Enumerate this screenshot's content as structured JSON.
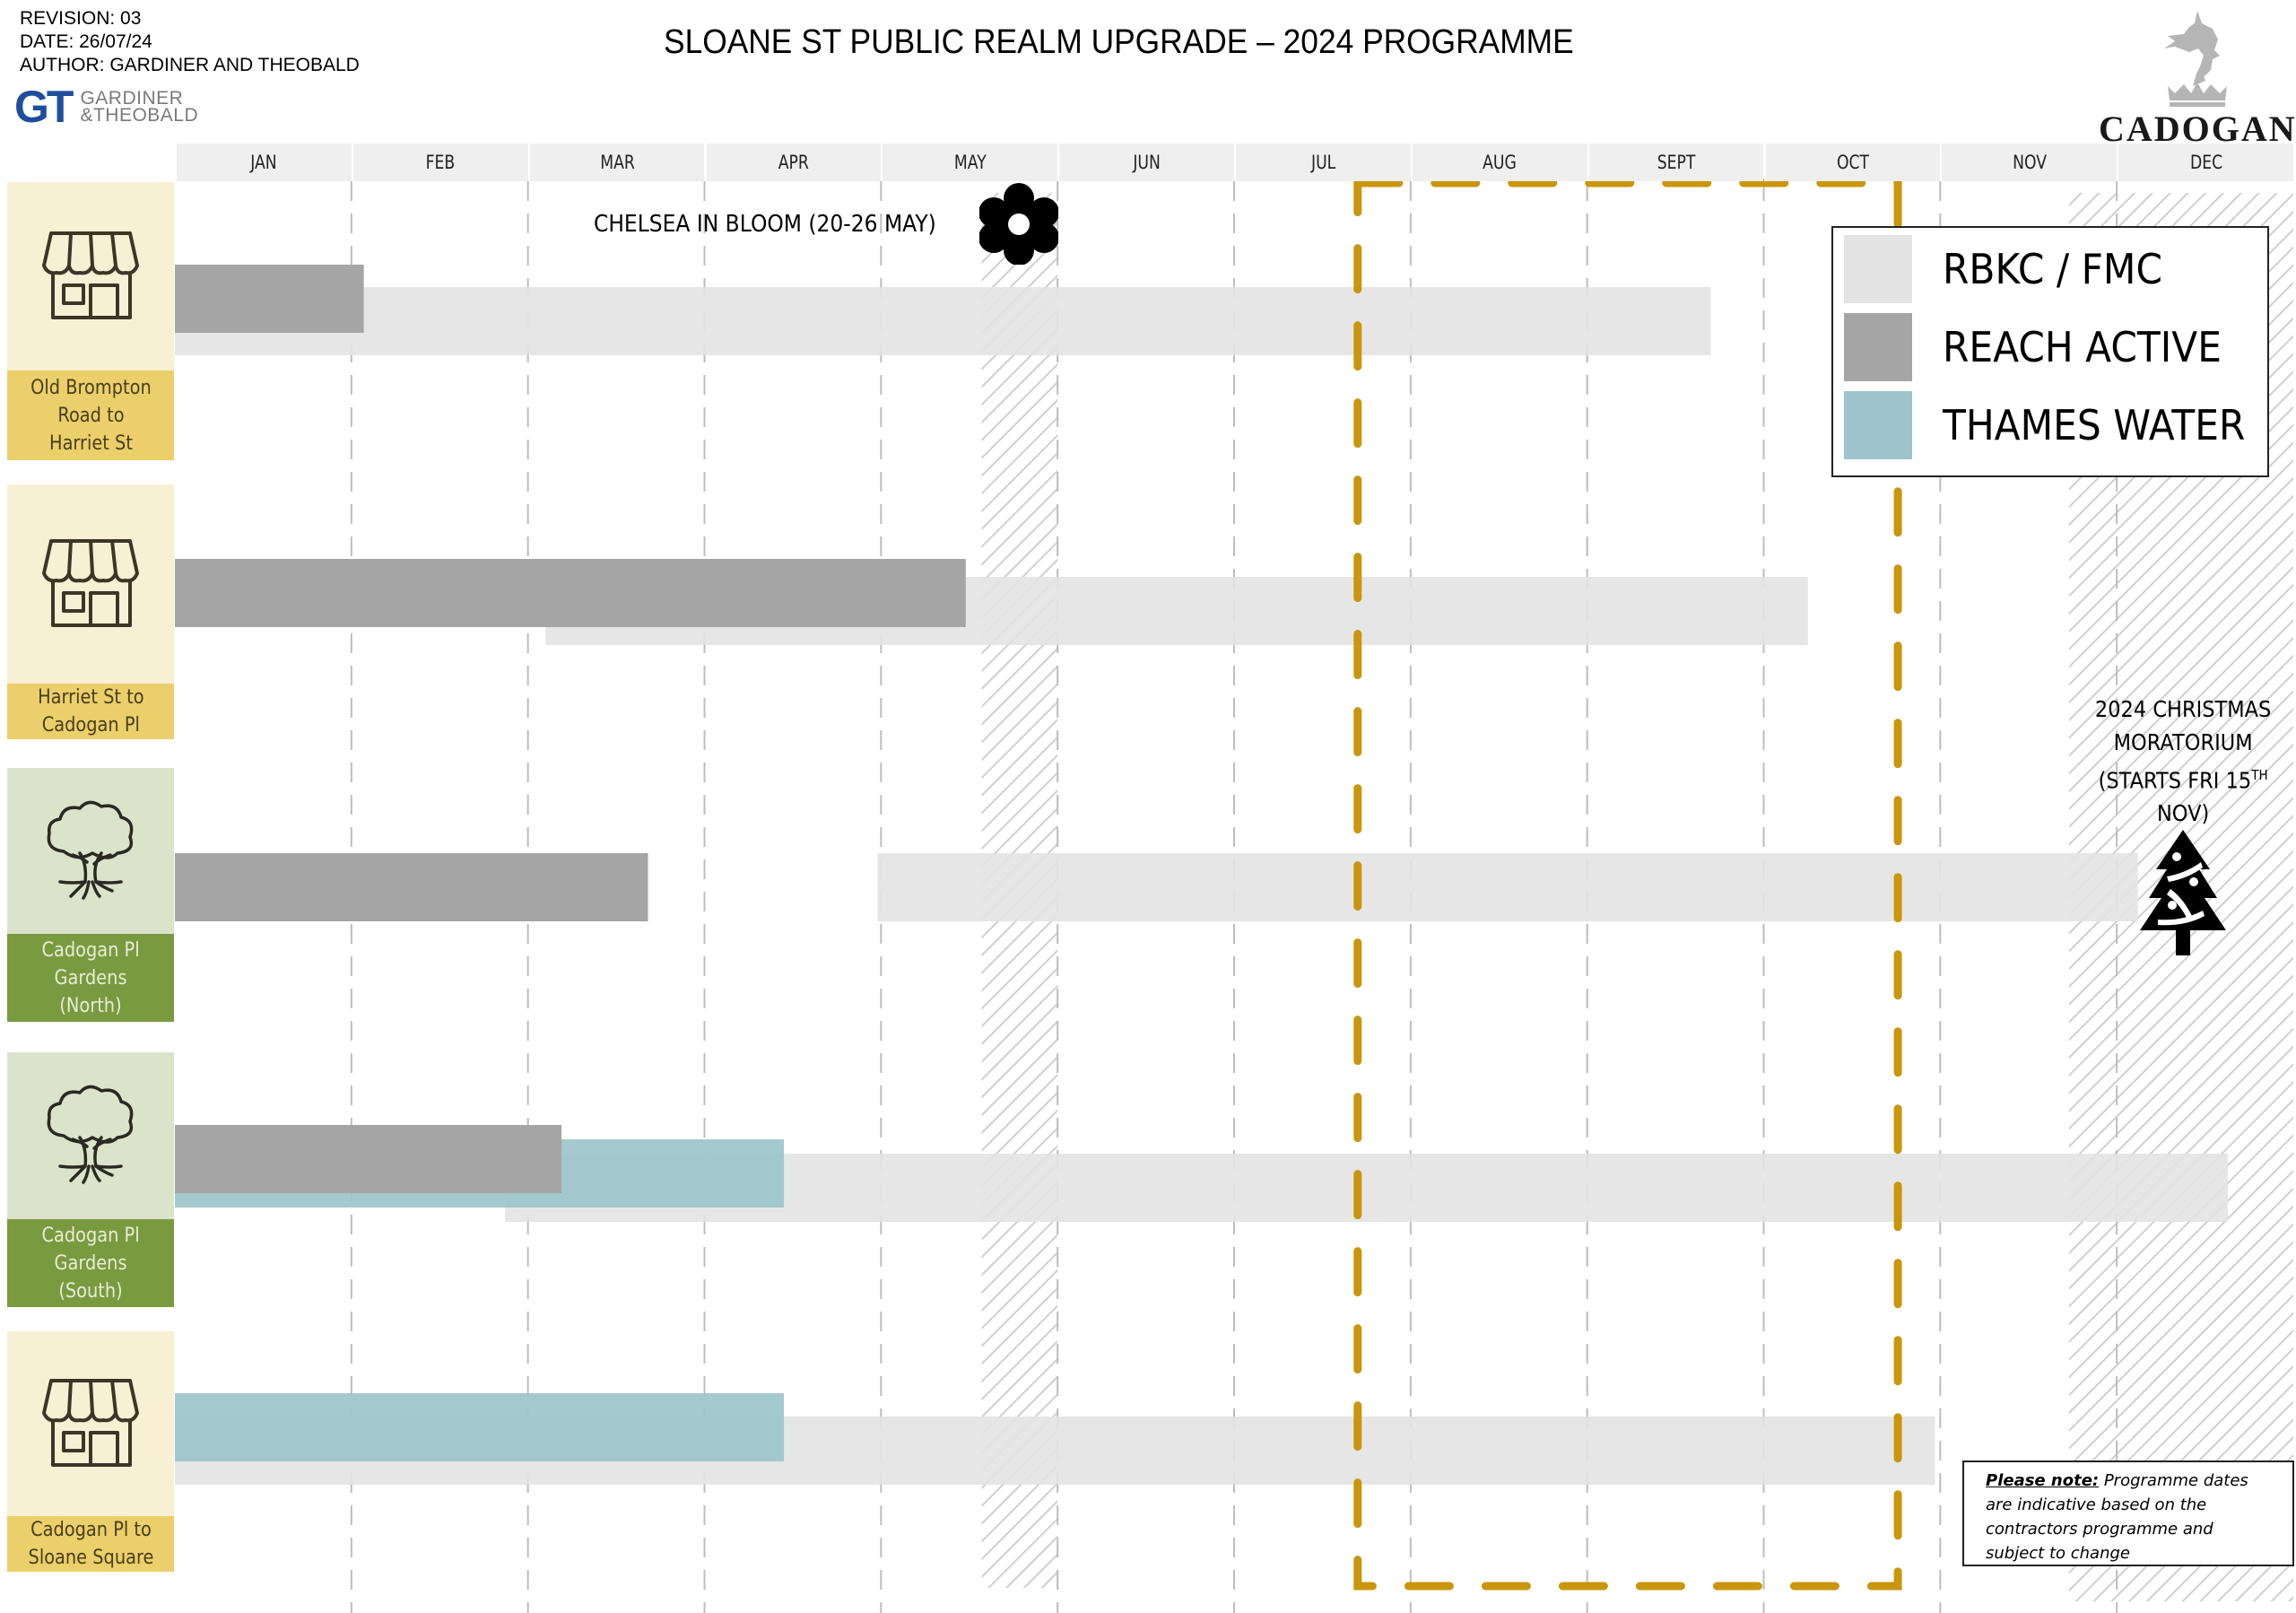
{
  "header": {
    "revision": "REVISION: 03",
    "date": "DATE: 26/07/24",
    "author": "AUTHOR: GARDINER AND THEOBALD",
    "gt_logo_mark": "GT",
    "gt_logo_line1": "GARDINER",
    "gt_logo_line2": "&THEOBALD",
    "title": "SLOANE ST PUBLIC REALM UPGRADE – 2024 PROGRAMME",
    "client_logo": "CADOGAN"
  },
  "legend": [
    {
      "label": "RBKC / FMC",
      "color": "#e3e3e3"
    },
    {
      "label": "REACH ACTIVE",
      "color": "#a5a5a5"
    },
    {
      "label": "THAMES WATER",
      "color": "#9cc4ca"
    }
  ],
  "annotations": {
    "chelsea": "CHELSEA IN BLOOM (20-26 MAY)",
    "chelsea_icon": "flower-icon",
    "xmas_line1": "2024 CHRISTMAS",
    "xmas_line2": "MORATORIUM",
    "xmas_line3": "(STARTS FRI 15",
    "xmas_sup": "TH",
    "xmas_line4": "NOV)",
    "xmas_icon": "christmas-tree-icon",
    "note_bold": "Please note:",
    "note_text": " Programme dates are indicative based on the contractors programme and subject to change"
  },
  "colors": {
    "shop_panel": "#f8f0d4",
    "shop_label": "#ebcf6a",
    "garden_panel": "#dbe3cb",
    "garden_label": "#7a9a40",
    "highlight_box": "#c9960c",
    "gridline": "#bdbdbd"
  },
  "chart_data": {
    "type": "gantt",
    "title": "SLOANE ST PUBLIC REALM UPGRADE – 2024 PROGRAMME",
    "x_unit": "months from 1 Jan 2024",
    "xlim": [
      0,
      12
    ],
    "categories": [
      "JAN",
      "FEB",
      "MAR",
      "APR",
      "MAY",
      "JUN",
      "JUL",
      "AUG",
      "SEPT",
      "OCT",
      "NOV",
      "DEC"
    ],
    "rows": [
      {
        "label": "Old Brompton\nRoad to\nHarriet St",
        "icon": "shop-icon",
        "theme": "shop",
        "bars": [
          {
            "series": "RBKC / FMC",
            "start": 0.0,
            "end": 8.7
          },
          {
            "series": "REACH ACTIVE",
            "start": 0.0,
            "end": 1.07
          }
        ]
      },
      {
        "label": "Harriet St to\nCadogan Pl",
        "icon": "shop-icon",
        "theme": "shop",
        "bars": [
          {
            "series": "RBKC / FMC",
            "start": 2.1,
            "end": 9.25
          },
          {
            "series": "REACH ACTIVE",
            "start": 0.0,
            "end": 4.48
          }
        ]
      },
      {
        "label": "Cadogan Pl\nGardens\n(North)",
        "icon": "tree-icon",
        "theme": "garden",
        "bars": [
          {
            "series": "RBKC / FMC",
            "start": 3.98,
            "end": 11.12
          },
          {
            "series": "REACH ACTIVE",
            "start": 0.0,
            "end": 2.68
          }
        ]
      },
      {
        "label": "Cadogan Pl\nGardens\n(South)",
        "icon": "tree-icon",
        "theme": "garden",
        "bars": [
          {
            "series": "RBKC / FMC",
            "start": 1.87,
            "end": 11.63
          },
          {
            "series": "THAMES WATER",
            "start": 0.0,
            "end": 3.45
          },
          {
            "series": "REACH ACTIVE",
            "start": 0.0,
            "end": 2.19
          }
        ]
      },
      {
        "label": "Cadogan Pl to\nSloane Square",
        "icon": "shop-icon",
        "theme": "shop",
        "bars": [
          {
            "series": "RBKC / FMC",
            "start": 0.0,
            "end": 9.97
          },
          {
            "series": "THAMES WATER",
            "start": 0.0,
            "end": 3.45
          }
        ]
      }
    ],
    "hatched_periods": [
      {
        "name": "Chelsea in Bloom",
        "start": 4.57,
        "end": 5.0
      },
      {
        "name": "Christmas moratorium",
        "start": 10.73,
        "end": 12.0
      }
    ],
    "highlight_period": {
      "start": 6.7,
      "end": 9.76
    },
    "grid": true,
    "legend_position": "top-right"
  }
}
